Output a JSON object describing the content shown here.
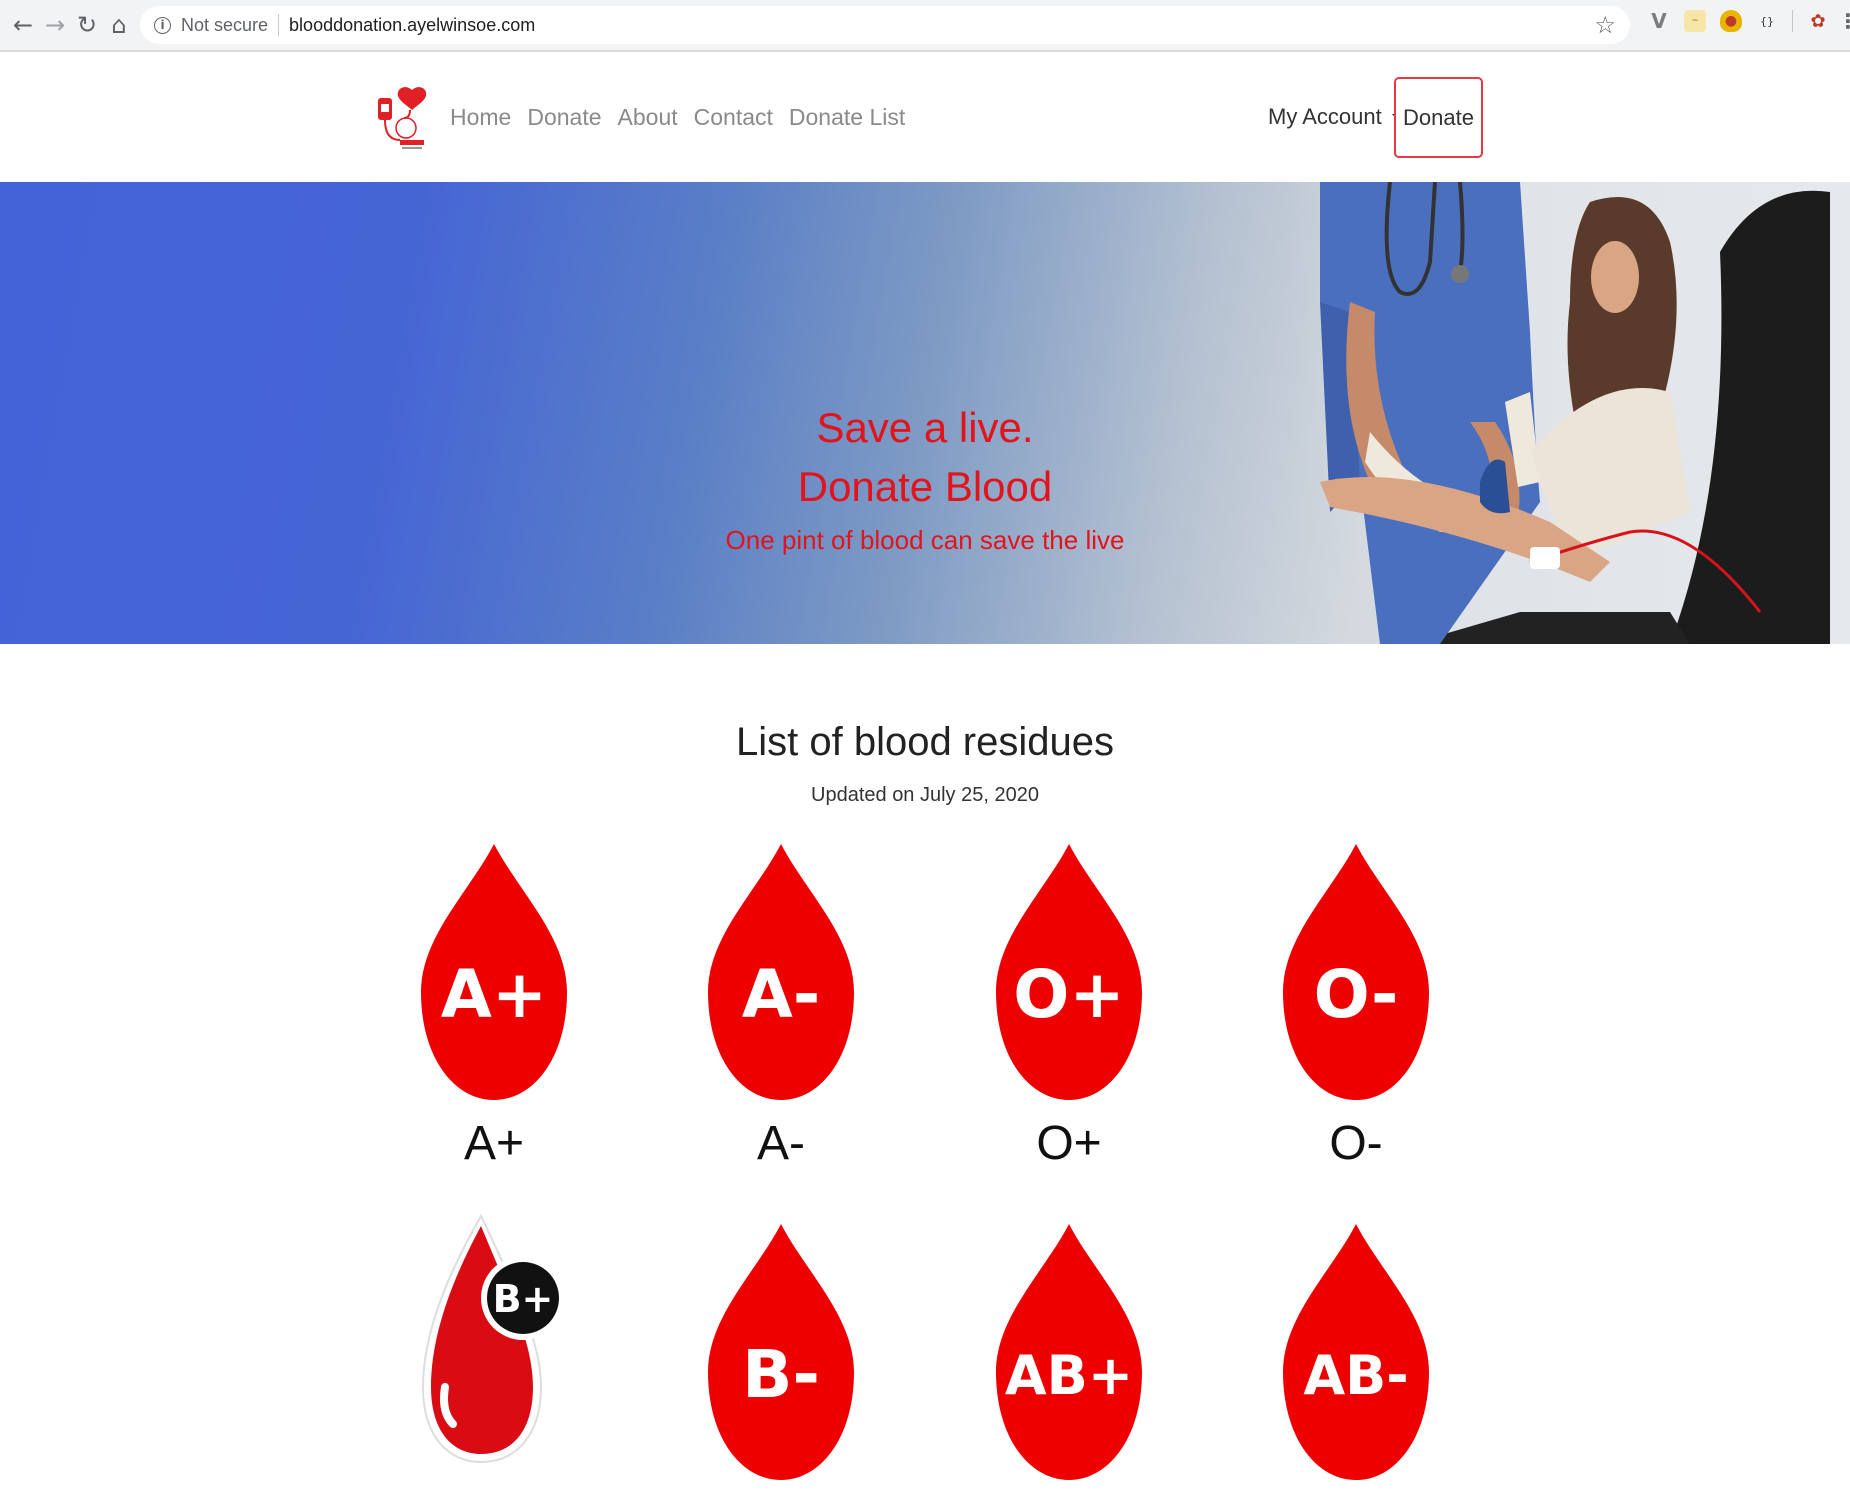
{
  "browser": {
    "security_label": "Not secure",
    "url": "blooddonation.ayelwinsoe.com",
    "icons": [
      "back-icon",
      "forward-icon",
      "reload-icon",
      "home-icon",
      "info-icon",
      "star-icon",
      "extension-icons",
      "menu-icon"
    ]
  },
  "nav": {
    "links": [
      "Home",
      "Donate",
      "About",
      "Contact",
      "Donate List"
    ],
    "account_label": "My Account",
    "donate_button": "Donate"
  },
  "hero": {
    "line1": "Save a live.",
    "line2": "Donate Blood",
    "tagline": "One pint of blood can save the live"
  },
  "residues": {
    "title": "List of blood residues",
    "updated": "Updated on July 25, 2020",
    "groups": [
      {
        "badge": "A+",
        "label": "A+"
      },
      {
        "badge": "A-",
        "label": "A-"
      },
      {
        "badge": "O+",
        "label": "O+"
      },
      {
        "badge": "O-",
        "label": "O-"
      },
      {
        "badge": "B+",
        "label": ""
      },
      {
        "badge": "B-",
        "label": ""
      },
      {
        "badge": "AB+",
        "label": ""
      },
      {
        "badge": "AB-",
        "label": ""
      }
    ]
  },
  "colors": {
    "brand_red": "#e1141c",
    "drop_red": "#ee0000",
    "hero_blue": "#4463d8"
  }
}
